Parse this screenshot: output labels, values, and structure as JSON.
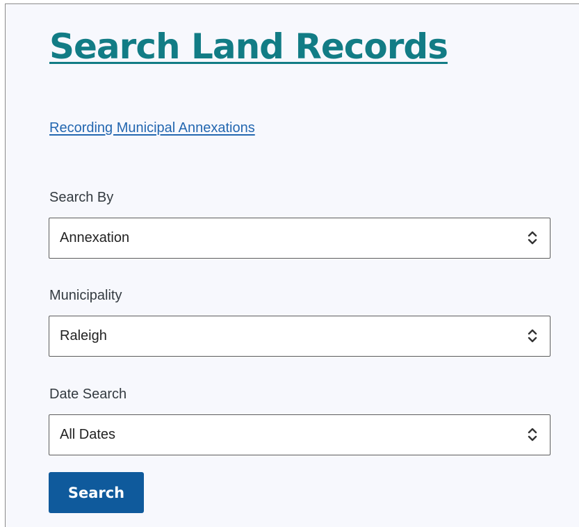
{
  "page": {
    "title": "Search Land Records",
    "link_text": "Recording Municipal Annexations"
  },
  "form": {
    "search_by": {
      "label": "Search By",
      "value": "Annexation"
    },
    "municipality": {
      "label": "Municipality",
      "value": "Raleigh"
    },
    "date_search": {
      "label": "Date Search",
      "value": "All Dates"
    },
    "submit_label": "Search"
  },
  "colors": {
    "title": "#127c85",
    "link": "#2367b0",
    "button": "#0f5a9c",
    "panel_background": "#f7f8fd"
  },
  "icons": {
    "select_indicator": "up-down-chevron-icon"
  }
}
